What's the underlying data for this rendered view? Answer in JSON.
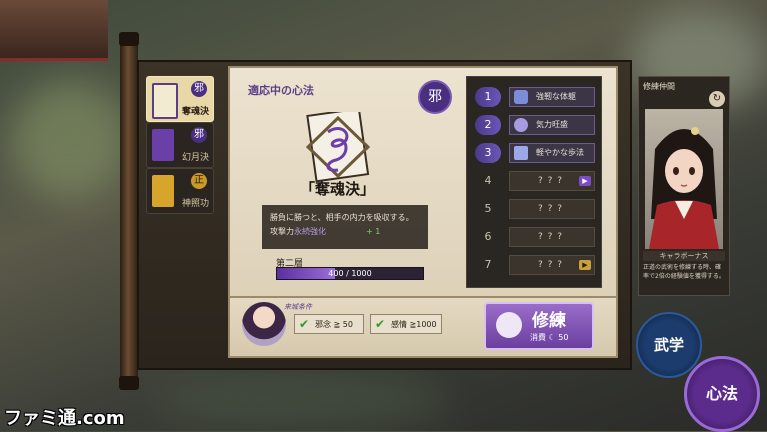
{
  "colors": {
    "accent_purple": "#5b3f86",
    "evil_badge": "#4a2f80",
    "good_badge": "#c99a25",
    "check_green": "#2f9a32",
    "bar_fill": "#7b4cc4"
  },
  "sidebar": {
    "tabs": [
      {
        "label": "奪魂決",
        "badge": "邪",
        "active": true,
        "icon": "book-icon"
      },
      {
        "label": "幻月決",
        "badge": "邪",
        "active": false,
        "icon": "book-icon"
      },
      {
        "label": "神照功",
        "badge": "正",
        "active": false,
        "icon": "book-icon"
      }
    ]
  },
  "main": {
    "section_title": "適応中の心法",
    "alignment_badge": "邪",
    "skill_name": "「奪魂決」",
    "description": "勝負に勝つと、相手の内力を吸収する。",
    "stat_label": "攻撃力",
    "stat_suffix": "永続強化",
    "stat_bonus": "+ 1",
    "layer_label": "第二層",
    "progress_text": "400 / 1000",
    "progress_fraction": 0.4
  },
  "levels": [
    {
      "number": "1",
      "label": "強靭な体躯",
      "unlocked": true
    },
    {
      "number": "2",
      "label": "気力旺盛",
      "unlocked": true
    },
    {
      "number": "3",
      "label": "軽やかな歩法",
      "unlocked": true
    },
    {
      "number": "4",
      "label": "? ? ?",
      "unlocked": false,
      "arrow": "purple"
    },
    {
      "number": "5",
      "label": "? ? ?",
      "unlocked": false
    },
    {
      "number": "6",
      "label": "? ? ?",
      "unlocked": false
    },
    {
      "number": "7",
      "label": "? ? ?",
      "unlocked": false,
      "arrow": "gold"
    }
  ],
  "requirements": {
    "title": "来城条件",
    "items": [
      {
        "text": "邪念 ≧ 50",
        "met": true
      },
      {
        "text": "感情 ≧1000",
        "met": true
      }
    ]
  },
  "train_button": {
    "label": "修練",
    "cost_prefix": "消費",
    "cost_value": "50"
  },
  "companion": {
    "title": "修練仲間",
    "name": "キャラボーナス",
    "bonus_text": "正道の武術を修練する時、確率で2倍の経験値を獲得する。"
  },
  "mode_buttons": {
    "martial": "武学",
    "mind": "心法"
  },
  "watermark": "ファミ通.com"
}
